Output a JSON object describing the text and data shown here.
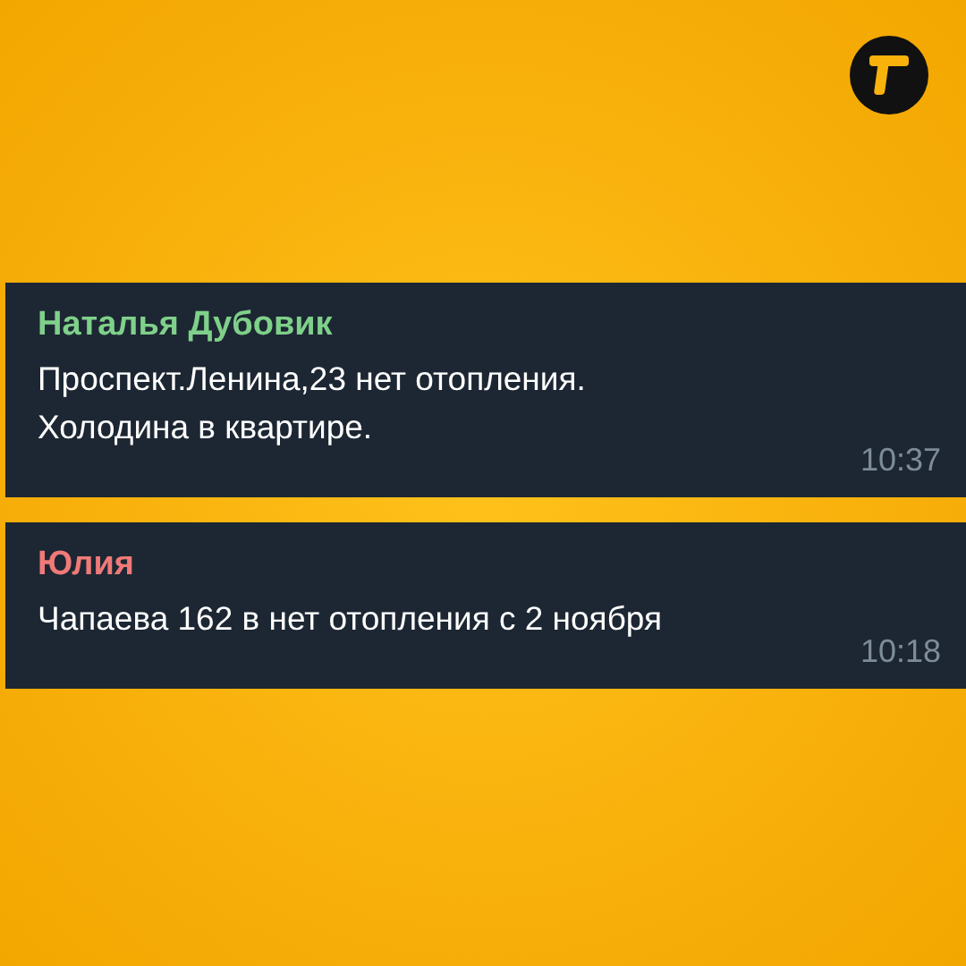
{
  "messages": [
    {
      "sender": "Наталья Дубовик",
      "color": "#7fd08a",
      "lines": [
        "Проспект.Ленина,23 нет отопления.",
        "Холодина в квартире."
      ],
      "time": "10:37"
    },
    {
      "sender": "Юлия",
      "color": "#f07a78",
      "lines": [
        "Чапаева 162 в нет отопления с 2 ноября"
      ],
      "time": "10:18"
    }
  ]
}
